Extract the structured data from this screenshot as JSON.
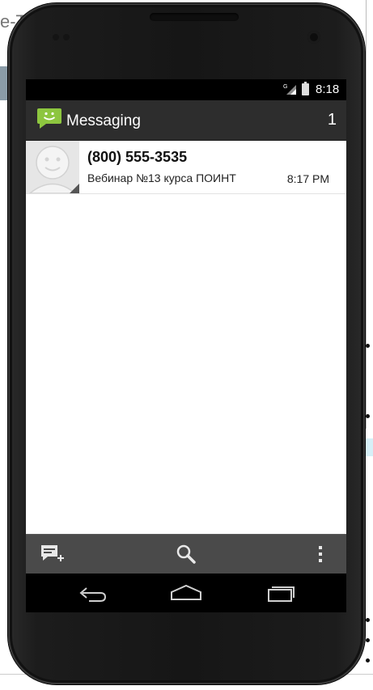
{
  "background": {
    "title_fragment": "e-T"
  },
  "status_bar": {
    "network_type": "G",
    "time": "8:18"
  },
  "action_bar": {
    "app_title": "Messaging",
    "app_icon": "messaging-icon",
    "unread_count": "1"
  },
  "conversations": [
    {
      "contact": "(800) 555-3535",
      "snippet": "Вебинар №13 курса ПОИНТ",
      "time": "8:17 PM",
      "avatar_icon": "default-contact-avatar"
    }
  ],
  "bottom_bar": {
    "compose_icon": "compose-message-icon",
    "search_icon": "search-icon",
    "menu_icon": "overflow-menu-icon"
  },
  "nav_bar": {
    "back_icon": "back-icon",
    "home_icon": "home-icon",
    "recents_icon": "recent-apps-icon"
  },
  "colors": {
    "action_bar": "#2d2d2d",
    "bottom_bar": "#4a4a4a",
    "app_icon_green": "#8dc63f"
  }
}
